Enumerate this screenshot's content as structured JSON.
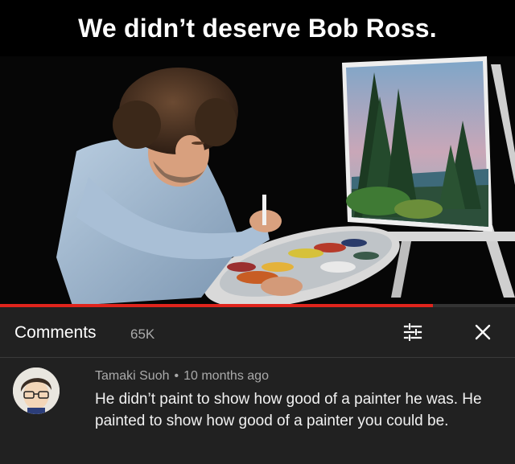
{
  "meme": {
    "caption": "We didn’t deserve Bob Ross."
  },
  "video": {
    "progress": 0.84
  },
  "comments": {
    "title": "Comments",
    "count": "65K",
    "sort_icon": "sort-filter-icon",
    "close_icon": "close-icon"
  },
  "comment": {
    "author": "Tamaki Suoh",
    "separator": "•",
    "time": "10 months ago",
    "text": "He didn’t paint to show how good of a painter he was. He painted to show how good of a painter you could be."
  },
  "colors": {
    "accent": "#e0241c",
    "panel": "#212121"
  }
}
